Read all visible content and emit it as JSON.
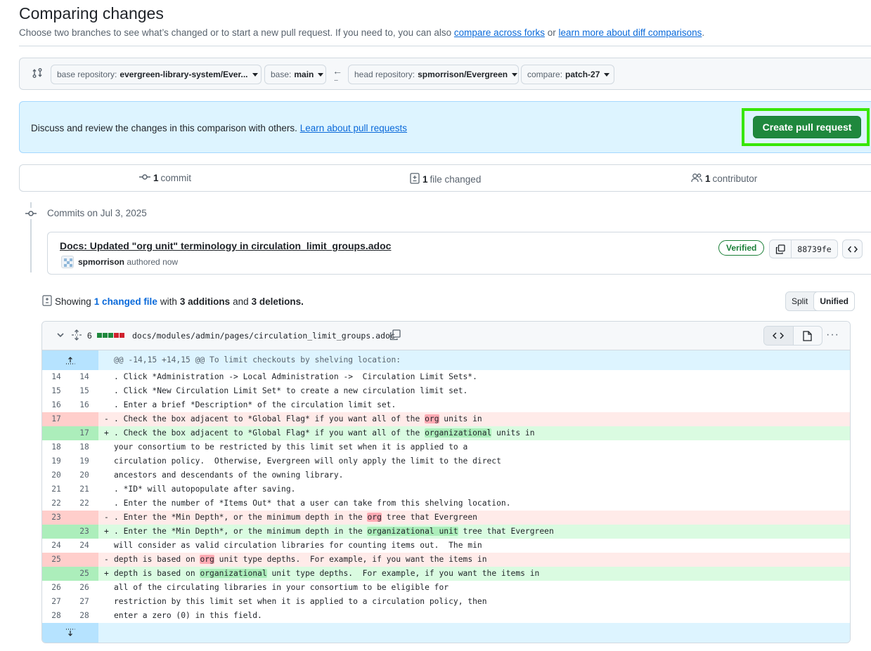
{
  "header": {
    "title": "Comparing changes",
    "subtitle_prefix": "Choose two branches to see what’s changed or to start a new pull request. If you need to, you can also",
    "compare_forks_link": "compare across forks",
    "or_text": "or",
    "learn_diff_link": "learn more about diff comparisons",
    "period": "."
  },
  "range": {
    "base_repo_label": "base repository:",
    "base_repo_value": "evergreen-library-system/Ever...",
    "base_label": "base:",
    "base_value": "main",
    "head_repo_label": "head repository:",
    "head_repo_value": "spmorrison/Evergreen",
    "compare_label": "compare:",
    "compare_value": "patch-27"
  },
  "flash": {
    "text": "Discuss and review the changes in this comparison with others.",
    "link": "Learn about pull requests",
    "cta": "Create pull request"
  },
  "summary": {
    "commits_count": "1",
    "commits_label": "commit",
    "files_count": "1",
    "files_label": "file changed",
    "contributors_count": "1",
    "contributors_label": "contributor"
  },
  "commits": {
    "date_heading": "Commits on Jul 3, 2025",
    "items": [
      {
        "title": "Docs: Updated \"org unit\" terminology in circulation_limit_groups.adoc",
        "author": "spmorrison",
        "authored": "authored now",
        "verified": "Verified",
        "sha": "88739fe"
      }
    ]
  },
  "diff_summary": {
    "showing": "Showing",
    "changed_files": "1 changed file",
    "with": "with",
    "additions": "3 additions",
    "and": "and",
    "deletions": "3 deletions.",
    "split": "Split",
    "unified": "Unified"
  },
  "file": {
    "change_count": "6",
    "diffstat": [
      "add",
      "add",
      "add",
      "del",
      "del"
    ],
    "path": "docs/modules/admin/pages/circulation_limit_groups.adoc",
    "hunk": "@@ -14,15 +14,15 @@ To limit checkouts by shelving location:",
    "lines": [
      {
        "type": "ctx",
        "l": "14",
        "r": "14",
        "text": ". Click *Administration -> Local Administration ->  Circulation Limit Sets*."
      },
      {
        "type": "ctx",
        "l": "15",
        "r": "15",
        "text": ". Click *New Circulation Limit Set* to create a new circulation limit set."
      },
      {
        "type": "ctx",
        "l": "16",
        "r": "16",
        "text": ". Enter a brief *Description* of the circulation limit set."
      },
      {
        "type": "del",
        "l": "17",
        "r": "",
        "pre": ". Check the box adjacent to *Global Flag* if you want all of the ",
        "hl": "org",
        "post": " units in"
      },
      {
        "type": "add",
        "l": "",
        "r": "17",
        "pre": ". Check the box adjacent to *Global Flag* if you want all of the ",
        "hl": "organizational",
        "post": " units in"
      },
      {
        "type": "ctx",
        "l": "18",
        "r": "18",
        "text": "your consortium to be restricted by this limit set when it is applied to a"
      },
      {
        "type": "ctx",
        "l": "19",
        "r": "19",
        "text": "circulation policy.  Otherwise, Evergreen will only apply the limit to the direct"
      },
      {
        "type": "ctx",
        "l": "20",
        "r": "20",
        "text": "ancestors and descendants of the owning library."
      },
      {
        "type": "ctx",
        "l": "21",
        "r": "21",
        "text": ". *ID* will autopopulate after saving."
      },
      {
        "type": "ctx",
        "l": "22",
        "r": "22",
        "text": ". Enter the number of *Items Out* that a user can take from this shelving location."
      },
      {
        "type": "del",
        "l": "23",
        "r": "",
        "pre": ". Enter the *Min Depth*, or the minimum depth in the ",
        "hl": "org",
        "post": " tree that Evergreen"
      },
      {
        "type": "add",
        "l": "",
        "r": "23",
        "pre": ". Enter the *Min Depth*, or the minimum depth in the ",
        "hl": "organizational unit",
        "post": " tree that Evergreen"
      },
      {
        "type": "ctx",
        "l": "24",
        "r": "24",
        "text": "will consider as valid circulation libraries for counting items out.  The min"
      },
      {
        "type": "del",
        "l": "25",
        "r": "",
        "pre": "depth is based on ",
        "hl": "org",
        "post": " unit type depths.  For example, if you want the items in"
      },
      {
        "type": "add",
        "l": "",
        "r": "25",
        "pre": "depth is based on ",
        "hl": "organizational",
        "post": " unit type depths.  For example, if you want the items in"
      },
      {
        "type": "ctx",
        "l": "26",
        "r": "26",
        "text": "all of the circulating libraries in your consortium to be eligible for"
      },
      {
        "type": "ctx",
        "l": "27",
        "r": "27",
        "text": "restriction by this limit set when it is applied to a circulation policy, then"
      },
      {
        "type": "ctx",
        "l": "28",
        "r": "28",
        "text": "enter a zero (0) in this field."
      }
    ]
  },
  "colors": {
    "accent": "#0969da",
    "primary_button": "#1f883d",
    "highlight_outline": "#37e600",
    "addition": "#dafbe1",
    "deletion": "#ffebe9"
  }
}
